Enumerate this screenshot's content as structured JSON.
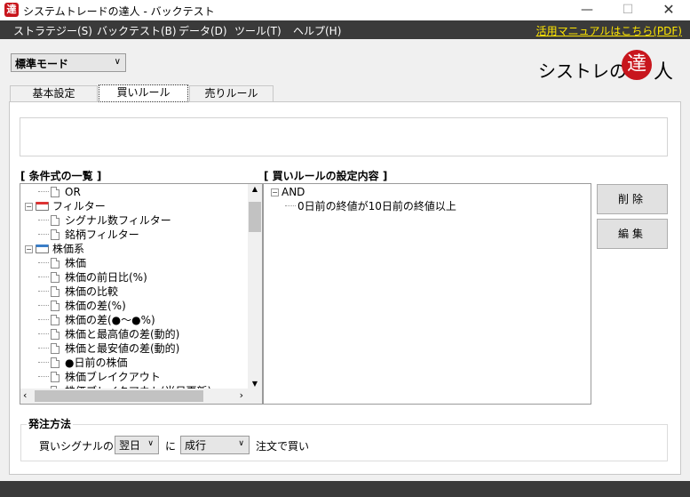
{
  "window": {
    "app_icon_glyph": "達",
    "title": "システムトレードの達人 - バックテスト",
    "minimize": "—",
    "maximize": "☐",
    "close": "✕"
  },
  "menu": {
    "items": [
      "ストラテジー(S)",
      "バックテスト(B)",
      "データ(D)",
      "ツール(T)",
      "ヘルプ(H)"
    ],
    "manual_link": "活用マニュアルはこちら(PDF)"
  },
  "mode_select": {
    "value": "標準モード"
  },
  "logo": {
    "text_before": "シストレの",
    "highlight": "達",
    "text_after": "人"
  },
  "tabs": [
    "基本設定",
    "買いルール",
    "売りルール"
  ],
  "conditions": {
    "label": "[ 条件式の一覧 ]",
    "items": [
      {
        "text": "OR",
        "kind": "doc",
        "level": 1
      },
      {
        "text": "フィルター",
        "kind": "folder-red",
        "level": 0
      },
      {
        "text": "シグナル数フィルター",
        "kind": "doc",
        "level": 1
      },
      {
        "text": "銘柄フィルター",
        "kind": "doc",
        "level": 1
      },
      {
        "text": "株価系",
        "kind": "folder-blue",
        "level": 0
      },
      {
        "text": "株価",
        "kind": "doc",
        "level": 1
      },
      {
        "text": "株価の前日比(%)",
        "kind": "doc",
        "level": 1
      },
      {
        "text": "株価の比較",
        "kind": "doc",
        "level": 1
      },
      {
        "text": "株価の差(%)",
        "kind": "doc",
        "level": 1
      },
      {
        "text": "株価の差(●〜●%)",
        "kind": "doc",
        "level": 1
      },
      {
        "text": "株価と最高値の差(動的)",
        "kind": "doc",
        "level": 1
      },
      {
        "text": "株価と最安値の差(動的)",
        "kind": "doc",
        "level": 1
      },
      {
        "text": "●日前の株価",
        "kind": "doc",
        "level": 1
      },
      {
        "text": "株価ブレイクアウト",
        "kind": "doc",
        "level": 1
      },
      {
        "text": "株価ブレイクアウト(当日更新)",
        "kind": "doc",
        "level": 1
      }
    ]
  },
  "rules": {
    "label": "[ 買いルールの設定内容 ]",
    "root": "AND",
    "items": [
      "0日前の終値が10日前の終値以上"
    ]
  },
  "buttons": {
    "delete": "削除",
    "edit": "編集"
  },
  "order": {
    "title": "発注方法",
    "prefix": "買いシグナルの",
    "timing": "翌日",
    "mid": "に",
    "type": "成行",
    "suffix": "注文で買い"
  },
  "colors": {
    "menu_bg": "#3a3a3a",
    "link": "#ffe600",
    "logo_red": "#c8161d"
  }
}
